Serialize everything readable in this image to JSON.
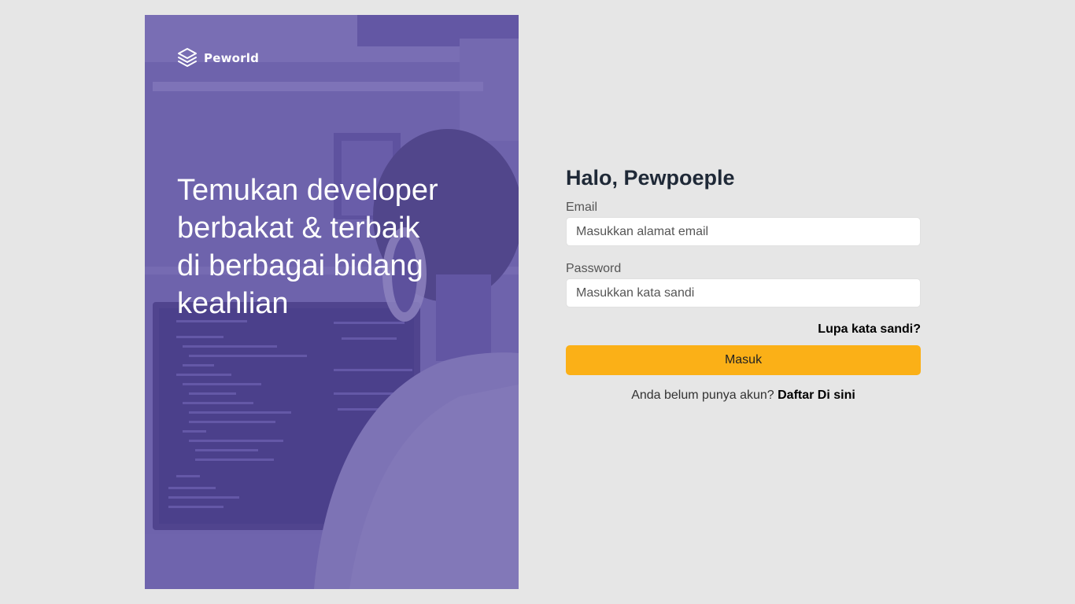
{
  "brand": {
    "name": "Peworld",
    "logo_icon": "layers-icon"
  },
  "hero": {
    "tagline_lines": [
      "Temukan developer",
      "berbakat & terbaik",
      "di berbagai bidang",
      "keahlian"
    ],
    "overlay_color": "#5e50a1"
  },
  "login": {
    "title": "Halo, Pewpoeple",
    "email_label": "Email",
    "email_placeholder": "Masukkan alamat email",
    "email_value": "",
    "password_label": "Password",
    "password_placeholder": "Masukkan kata sandi",
    "password_value": "",
    "forgot_label": "Lupa kata sandi?",
    "submit_label": "Masuk",
    "signup_prompt": "Anda belum punya akun?",
    "signup_link": "Daftar Di sini"
  },
  "colors": {
    "page_background": "#e6e6e6",
    "accent": "#fbb017",
    "hero_tint": "#5e50a1"
  }
}
